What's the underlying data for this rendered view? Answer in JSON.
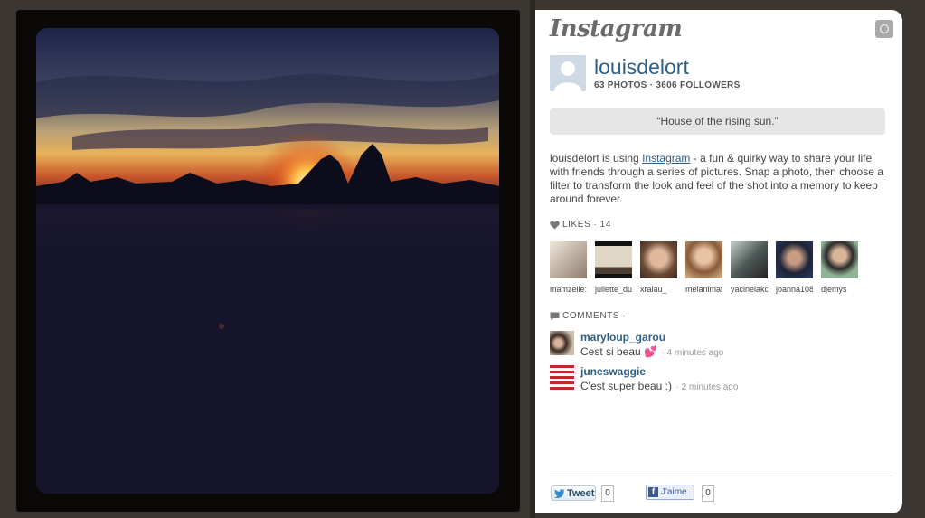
{
  "brand": {
    "logo_text": "Instagram"
  },
  "profile": {
    "username": "louisdelort",
    "stats": "63 PHOTOS · 3606 FOLLOWERS"
  },
  "caption": "“House of the rising sun.”",
  "description": {
    "before": "louisdelort is using ",
    "link": "Instagram",
    "after": " - a fun & quirky way to share your life with friends through a series of pictures. Snap a photo, then choose a filter to transform the look and feel of the shot into a memory to keep around forever."
  },
  "likes": {
    "label": "LIKES",
    "count": "· 14",
    "users": [
      {
        "name": "mamzelle:",
        "color": "#c8bcae"
      },
      {
        "name": "juliette_du",
        "color": "#d9cfc0"
      },
      {
        "name": "xralau_",
        "color": "#9a7c63"
      },
      {
        "name": "melanimat",
        "color": "#caa079"
      },
      {
        "name": "yacinelakc",
        "color": "#7e8a86"
      },
      {
        "name": "joanna108",
        "color": "#2c3a55"
      },
      {
        "name": "djemys",
        "color": "#7d9e84"
      }
    ]
  },
  "comments": {
    "label": "COMMENTS",
    "dot": "·",
    "items": [
      {
        "user": "maryloup_garou",
        "text": "Cest si beau 💕",
        "time": "· 4 minutes ago"
      },
      {
        "user": "juneswaggie",
        "text": "C'est super beau :)",
        "time": "· 2 minutes ago"
      }
    ]
  },
  "share": {
    "tweet_label": "Tweet",
    "tweet_count": "0",
    "fb_label": "J'aime",
    "fb_count": "0"
  }
}
